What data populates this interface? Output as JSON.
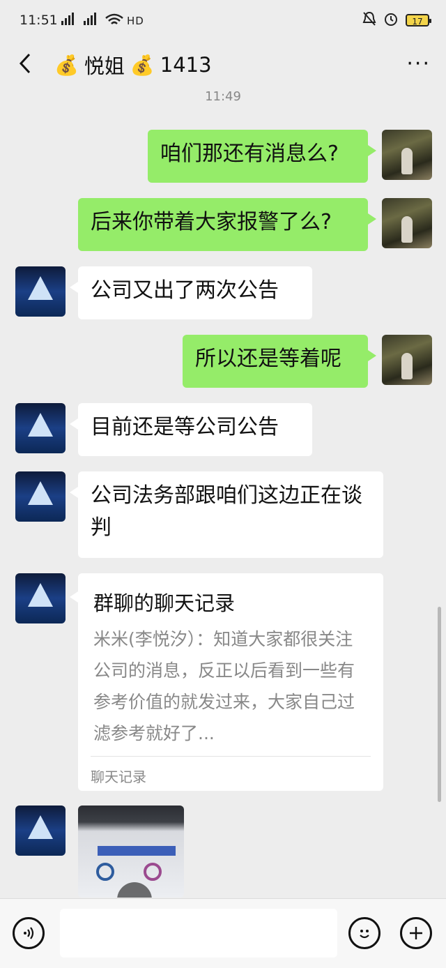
{
  "status_bar": {
    "time": "11:51",
    "network": "4G 2G",
    "hd": "HD",
    "battery": "17"
  },
  "header": {
    "title": "悦姐",
    "count": "1413",
    "emoji": "💰",
    "more": "···"
  },
  "timestamp": "11:49",
  "messages": [
    {
      "side": "me",
      "text": "咱们那还有消息么?"
    },
    {
      "side": "me",
      "text": "后来你带着大家报警了么?"
    },
    {
      "side": "other",
      "text": "公司又出了两次公告"
    },
    {
      "side": "me",
      "text": "所以还是等着呢"
    },
    {
      "side": "other",
      "text": "目前还是等公司公告"
    },
    {
      "side": "other",
      "text": "公司法务部跟咱们这边正在谈判"
    }
  ],
  "chat_record": {
    "title": "群聊的聊天记录",
    "body": "米米(李悦汐）：知道大家都很关注公司的消息，反正以后看到一些有参考价值的就发过来，大家自己过滤参考就好了...",
    "footer": "聊天记录"
  },
  "input_bar": {
    "placeholder": ""
  }
}
